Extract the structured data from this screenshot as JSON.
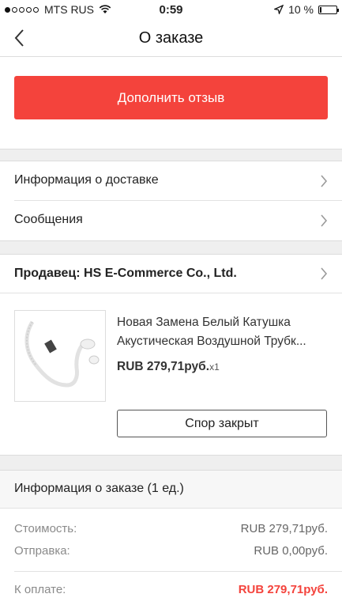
{
  "status_bar": {
    "carrier": "MTS RUS",
    "time": "0:59",
    "battery": "10 %"
  },
  "nav": {
    "title": "О заказе"
  },
  "actions": {
    "review_button": "Дополнить отзыв"
  },
  "links": {
    "delivery_info": "Информация о доставке",
    "messages": "Сообщения"
  },
  "seller": {
    "label": "Продавец: HS E-Commerce Co., Ltd."
  },
  "product": {
    "title_line1": "Новая Замена Белый Катушка",
    "title_line2": "Акустическая Воздушной Трубк...",
    "price": "RUB 279,71руб.",
    "quantity": "x1",
    "dispute_button": "Спор закрыт"
  },
  "order_info": {
    "header": "Информация о заказе (1 ед.)",
    "cost_label": "Стоимость:",
    "cost_value": "RUB 279,71руб.",
    "shipping_label": "Отправка:",
    "shipping_value": "RUB 0,00руб.",
    "total_label": "К оплате:",
    "total_value": "RUB 279,71руб."
  },
  "colors": {
    "accent": "#f4433c",
    "background_gap": "#efefef"
  }
}
